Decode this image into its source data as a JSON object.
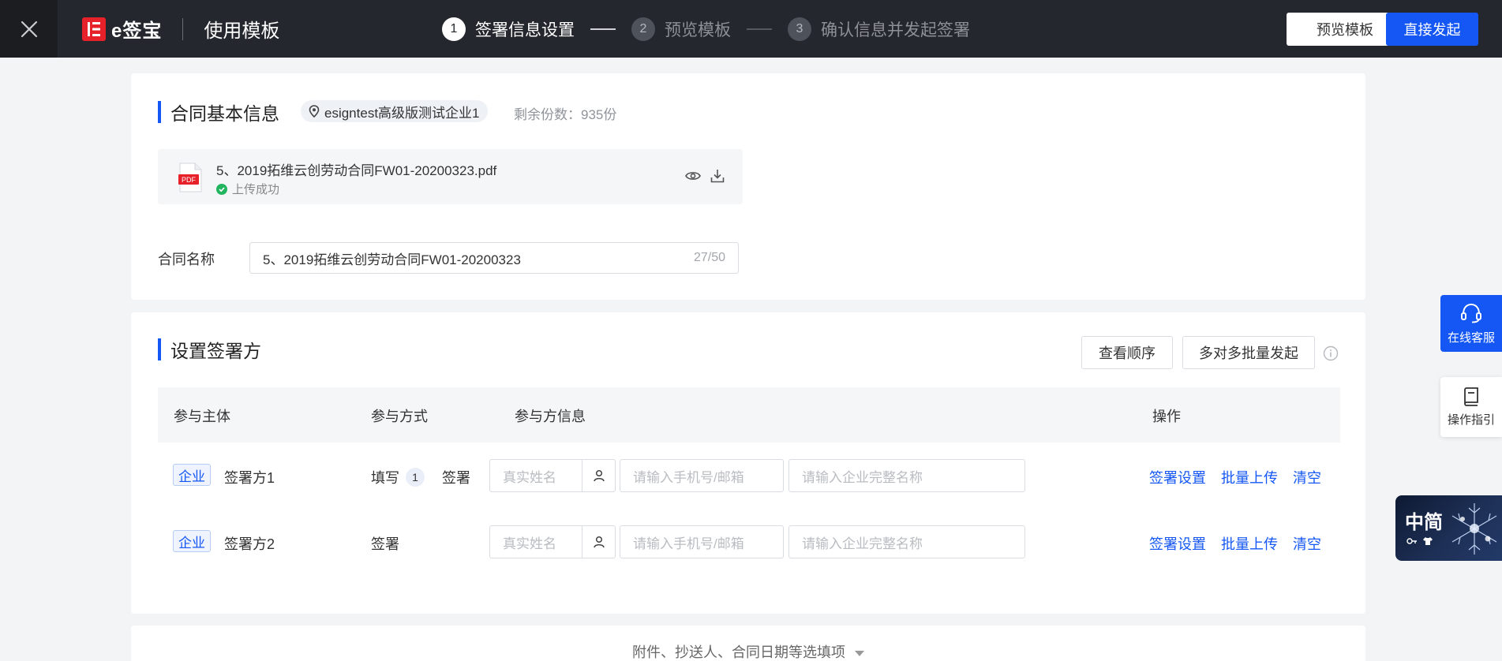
{
  "header": {
    "logo_text": "e签宝",
    "title": "使用模板",
    "steps": [
      {
        "num": "1",
        "label": "签署信息设置"
      },
      {
        "num": "2",
        "label": "预览模板"
      },
      {
        "num": "3",
        "label": "确认信息并发起签署"
      }
    ],
    "preview_button": "预览模板",
    "launch_button": "直接发起"
  },
  "contract_info": {
    "title": "合同基本信息",
    "org_name": "esigntest高级版测试企业1",
    "remaining": "剩余份数：935份",
    "file": {
      "icon_label": "PDF",
      "name": "5、2019拓维云创劳动合同FW01-20200323.pdf",
      "status": "上传成功"
    },
    "name_label": "合同名称",
    "name_value": "5、2019拓维云创劳动合同FW01-20200323",
    "name_count": "27/50"
  },
  "signers": {
    "title": "设置签署方",
    "view_order_button": "查看顺序",
    "batch_button": "多对多批量发起",
    "columns": [
      "参与主体",
      "参与方式",
      "参与方信息",
      "操作"
    ],
    "rows": [
      {
        "tag": "企业",
        "party": "签署方1",
        "mode": "填写",
        "mode_badge": "1",
        "mode2": "签署",
        "name_placeholder": "真实姓名",
        "phone_placeholder": "请输入手机号/邮箱",
        "company_placeholder": "请输入企业完整名称",
        "actions": [
          "签署设置",
          "批量上传",
          "清空"
        ]
      },
      {
        "tag": "企业",
        "party": "签署方2",
        "mode": "签署",
        "name_placeholder": "真实姓名",
        "phone_placeholder": "请输入手机号/邮箱",
        "company_placeholder": "请输入企业完整名称",
        "actions": [
          "签署设置",
          "批量上传",
          "清空"
        ]
      }
    ]
  },
  "more_options": "附件、抄送人、合同日期等选填项",
  "floats": {
    "customer_service": "在线客服",
    "guide": "操作指引",
    "promo_text": "中简"
  },
  "colors": {
    "accent": "#1557f5",
    "topbar": "#24272d",
    "success": "#22b45e",
    "pdf_red": "#e6212a"
  }
}
